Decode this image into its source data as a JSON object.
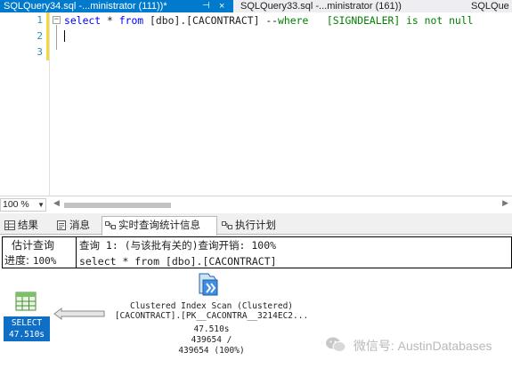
{
  "tabs": [
    {
      "label": "SQLQuery34.sql -...ministrator (111))*",
      "active": true,
      "pin": "⊣",
      "close": "×"
    },
    {
      "label": "SQLQuery33.sql -...ministrator (161))",
      "active": false
    },
    {
      "label": "SQLQue",
      "active": false
    }
  ],
  "editor": {
    "line_numbers": [
      "1",
      "2",
      "3"
    ],
    "fold": "−",
    "line1": {
      "kw1": "select",
      "t1": " * ",
      "kw2": "from",
      "t2": " [dbo].[CACONTRACT] --",
      "comment1": "where",
      "comment2": "   [SIGNDEALER] is not null"
    }
  },
  "zoom": {
    "value": "100 %"
  },
  "result_tabs": [
    {
      "label": "结果",
      "icon": "grid-icon"
    },
    {
      "label": "消息",
      "icon": "message-icon"
    },
    {
      "label": "实时查询统计信息",
      "icon": "live-stats-icon",
      "active": true
    },
    {
      "label": "执行计划",
      "icon": "execution-plan-icon"
    }
  ],
  "stats": {
    "estimate_line1": "估计查询",
    "estimate_line2": "进度:",
    "estimate_progress": "100%",
    "query_line1": "查询 1: (与该批有关的)查询开销: 100%",
    "query_line2": "select * from [dbo].[CACONTRACT]"
  },
  "plan": {
    "select": {
      "name": "SELECT",
      "time": "47.510s"
    },
    "scan": {
      "title": "Clustered Index Scan (Clustered)",
      "object": "[CACONTRACT].[PK__CACONTRA__3214EC2...",
      "time": "47.510s",
      "rows_line1": "439654 /",
      "rows_line2": "439654 (100%)"
    }
  },
  "watermark": {
    "text": "微信号: AustinDatabases"
  },
  "colors": {
    "accent": "#007acc",
    "select_label": "#0f6fc6",
    "keyword": "#0000ff",
    "comment": "#008000",
    "line_number": "#2b91af"
  }
}
